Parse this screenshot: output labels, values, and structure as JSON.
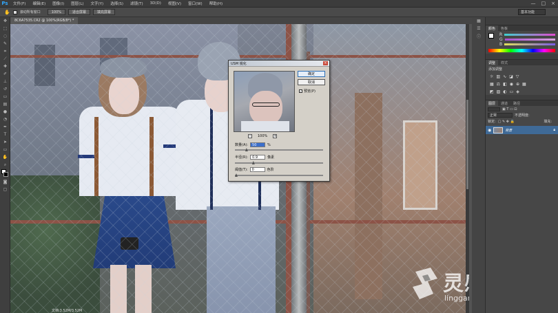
{
  "app": {
    "logo": "Ps"
  },
  "menu": [
    "文件(F)",
    "编辑(E)",
    "图像(I)",
    "图层(L)",
    "文字(Y)",
    "选择(S)",
    "滤镜(T)",
    "3D(D)",
    "视图(V)",
    "窗口(W)",
    "帮助(H)"
  ],
  "window_controls": [
    "—",
    "□",
    "×"
  ],
  "options": {
    "checkbox_label": "滚动所有窗口",
    "buttons": [
      "100%",
      "适合屏幕",
      "填充屏幕"
    ],
    "workspace": "基本功能"
  },
  "document": {
    "tab": "8C6A7535.CR2 @ 100%(RGB/8*) *",
    "status": "文档:3.52M/3.52M"
  },
  "dialog": {
    "title": "USM 锐化",
    "ok": "确定",
    "cancel": "取消",
    "preview_label": "预览(P)",
    "preview_checked": "✓",
    "zoom": "100%",
    "zoom_minus": "−",
    "zoom_plus": "+",
    "amount_label": "数量(A):",
    "amount_value": "50",
    "amount_unit": "%",
    "amount_level": 0.12,
    "radius_label": "半径(R):",
    "radius_value": "0.9",
    "radius_unit": "像素",
    "radius_level": 0.2,
    "threshold_label": "阈值(T):",
    "threshold_value": "0",
    "threshold_unit": "色阶",
    "threshold_level": 0.0
  },
  "panels": {
    "color": {
      "tabs": [
        "颜色",
        "色板"
      ],
      "sliders": [
        {
          "label": "R",
          "color": "#e14bd0"
        },
        {
          "label": "G",
          "color": "#d9a3e0"
        },
        {
          "label": "B",
          "color": "#7a5ce6"
        }
      ]
    },
    "adjust": {
      "tabs": [
        "调整",
        "样式"
      ],
      "title": "添加调整"
    },
    "layers": {
      "tabs": [
        "图层",
        "通道",
        "路径"
      ],
      "mode": "正常",
      "opacity_label": "不透明度:",
      "fill_label": "填充:",
      "lock_label": "锁定:",
      "layer_name": "背景"
    }
  },
  "watermark": {
    "cn": "灵感中国",
    "en": "lingganchina.com"
  },
  "colors": {
    "accent": "#31a8ff",
    "selected_layer": "#3f6a97"
  }
}
